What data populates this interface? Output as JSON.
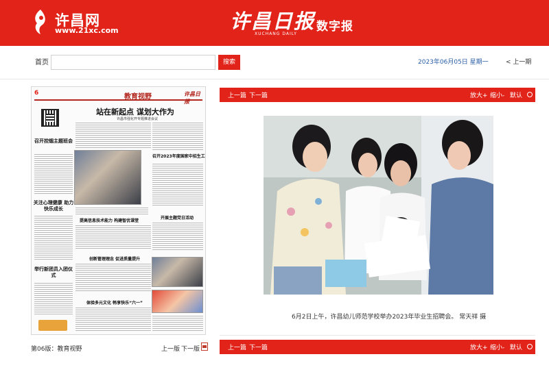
{
  "header": {
    "site_name": "许昌网",
    "site_url": "www.21xc.com",
    "masthead": "许昌日报",
    "masthead_en": "XUCHANG DAILY",
    "edition_label": "数字报",
    "brand_color": "#e2231a"
  },
  "nav": {
    "home": "首页",
    "search_value": "",
    "search_button": "搜索",
    "date": "2023年06月05日 星期一",
    "prev_period": "< 上一期"
  },
  "page_thumbnail": {
    "page_number": "6",
    "section_title": "教育视野",
    "paper_name": "许昌日报",
    "lead_title": "站在新起点 谋划大作为",
    "lead_subtitle": "许昌市强化开专题推进会议",
    "side_headings": [
      "召开控烟主题班会",
      "关注心理健康 助力快乐成长",
      "举行新团员入团仪式"
    ],
    "article_headings": [
      "召开2023年度国家中招生工作会议",
      "开展主题党日活动",
      "提高信息技术能力 构建智优课堂",
      "创新管理理念 促进质量提升",
      "体验多元文化 畅享快乐“六一”"
    ]
  },
  "page_footer": {
    "edition_name": "第06版：教育视野",
    "prev_page": "上一版",
    "next_page": "下一版"
  },
  "toolbar": {
    "prev": "上一篇",
    "next": "下一篇",
    "zoom_in": "放大+",
    "zoom_out": "缩小-",
    "default": "默认"
  },
  "article": {
    "caption": "6月2日上午，许昌幼儿师范学校举办2023年毕业生招聘会。 常天祥 摄"
  }
}
